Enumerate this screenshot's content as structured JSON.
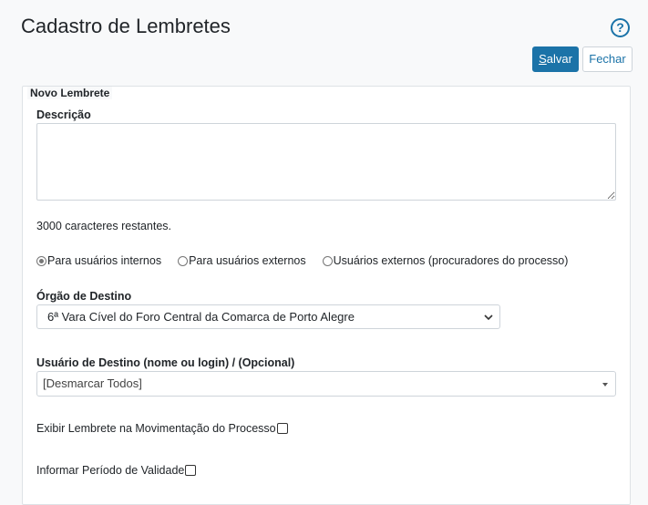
{
  "header": {
    "title": "Cadastro de Lembretes",
    "help_symbol": "?"
  },
  "toolbar": {
    "save_label_accesskey": "S",
    "save_label_rest": "alvar",
    "close_label": "Fechar"
  },
  "form": {
    "legend": "Novo Lembrete",
    "description_label": "Descrição",
    "description_value": "",
    "chars_remaining": "3000 caracteres restantes.",
    "audience_options": [
      {
        "label": "Para usuários internos",
        "checked": true
      },
      {
        "label": "Para usuários externos",
        "checked": false
      },
      {
        "label": "Usuários externos (procuradores do processo)",
        "checked": false
      }
    ],
    "orgao_label": "Órgão de Destino",
    "orgao_value": "6ª Vara Cível do Foro Central da Comarca de Porto Alegre",
    "usuario_label": "Usuário de Destino (nome ou login) / (Opcional)",
    "usuario_value": "[Desmarcar Todos]",
    "exibir_label": "Exibir Lembrete na Movimentação do Processo",
    "exibir_checked": false,
    "periodo_label": "Informar Período de Validade",
    "periodo_checked": false
  },
  "colors": {
    "primary": "#1b73a8",
    "background": "#f8f9fa",
    "border": "#ced4da"
  }
}
